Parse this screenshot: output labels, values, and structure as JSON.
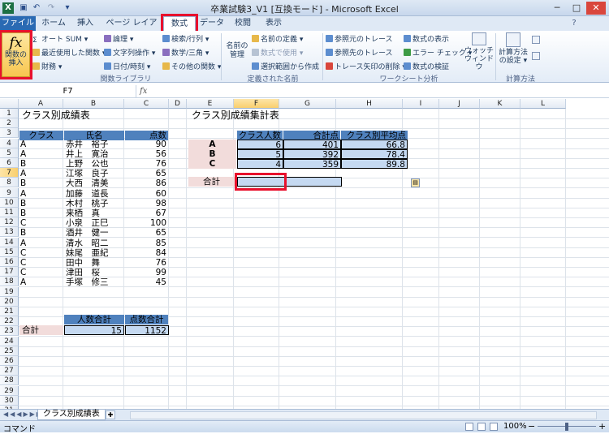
{
  "window": {
    "title": "卒業試験3_V1 [互換モード] - Microsoft Excel",
    "excel_icon": "X",
    "quick_access_icons": [
      "save-icon",
      "undo-icon",
      "redo-icon",
      "customize-icon"
    ],
    "controls": [
      "─",
      "□",
      "✕"
    ]
  },
  "tabs": [
    "ファイル",
    "ホーム",
    "挿入",
    "ページ レイアウト",
    "数式",
    "データ",
    "校閲",
    "表示"
  ],
  "ribbon": {
    "insert_function": "関数の挿入",
    "insert_function_icon": "fx",
    "library": {
      "col1": [
        "オート SUM ▾",
        "最近使用した関数 ▾",
        "財務 ▾"
      ],
      "col2": [
        "論理 ▾",
        "文字列操作 ▾",
        "日付/時刻 ▾"
      ],
      "col3": [
        "検索/行列 ▾",
        "数学/三角 ▾",
        "その他の関数 ▾"
      ],
      "label": "関数ライブラリ"
    },
    "names": {
      "manager": "名前の管理",
      "items": [
        "名前の定義 ▾",
        "数式で使用 ▾",
        "選択範囲から作成"
      ],
      "label": "定義された名前"
    },
    "audit": {
      "col1": [
        "参照元のトレース",
        "参照先のトレース",
        "トレース矢印の削除 ▾"
      ],
      "col2": [
        "数式の表示",
        "エラー チェック ▾",
        "数式の検証"
      ],
      "watch": "ウォッチ ウィンドウ",
      "label": "ワークシート分析"
    },
    "calc": {
      "options": "計算方法の設定 ▾",
      "label": "計算方法"
    }
  },
  "formula_bar": {
    "name_box": "F7",
    "fx": "fx",
    "content": ""
  },
  "columns": [
    "A",
    "B",
    "C",
    "D",
    "E",
    "F",
    "G",
    "H",
    "I",
    "J",
    "K",
    "L"
  ],
  "rows": [
    "1",
    "2",
    "3",
    "4",
    "5",
    "6",
    "7",
    "8",
    "9",
    "10",
    "11",
    "12",
    "13",
    "14",
    "15",
    "16",
    "17",
    "18",
    "19",
    "20",
    "21",
    "22",
    "23",
    "24",
    "25",
    "26",
    "27",
    "28",
    "29",
    "30",
    "31"
  ],
  "sheet": {
    "title_left": "クラス別成績表",
    "title_right": "クラス別成績集計表",
    "left_headers": [
      "クラス",
      "氏名",
      "点数"
    ],
    "left_rows": [
      [
        "A",
        "赤井　裕子",
        "90"
      ],
      [
        "A",
        "井上　寛治",
        "56"
      ],
      [
        "B",
        "上野　公也",
        "76"
      ],
      [
        "A",
        "江塚　良子",
        "65"
      ],
      [
        "B",
        "大西　清美",
        "86"
      ],
      [
        "A",
        "加藤　道長",
        "60"
      ],
      [
        "B",
        "木村　桃子",
        "98"
      ],
      [
        "B",
        "来栖　真",
        "67"
      ],
      [
        "C",
        "小泉　正巳",
        "100"
      ],
      [
        "B",
        "酒井　健一",
        "65"
      ],
      [
        "A",
        "清水　昭二",
        "85"
      ],
      [
        "C",
        "妹尾　亜紀",
        "84"
      ],
      [
        "C",
        "田中　舞",
        "76"
      ],
      [
        "C",
        "津田　桜",
        "99"
      ],
      [
        "A",
        "手塚　修三",
        "45"
      ]
    ],
    "left_total_headers": [
      "人数合計",
      "点数合計"
    ],
    "left_total_label": "合計",
    "left_totals": [
      "15",
      "1152"
    ],
    "right_headers": [
      "クラス人数",
      "合計点",
      "クラス別平均点"
    ],
    "right_rows": [
      [
        "A",
        "6",
        "401",
        "66.8"
      ],
      [
        "B",
        "5",
        "392",
        "78.4"
      ],
      [
        "C",
        "4",
        "359",
        "89.8"
      ]
    ],
    "right_total_label": "合計",
    "paste_icon": "paste-options-icon"
  },
  "sheet_tab": "クラス別成績表",
  "status": {
    "mode": "コマンド",
    "zoom": "100%",
    "minus": "−",
    "plus": "+"
  },
  "colors": {
    "accent": "#4f81bd",
    "file_tab": "#2a6ab3",
    "highlight": "#e8112d",
    "pink": "#f2dcdb"
  }
}
